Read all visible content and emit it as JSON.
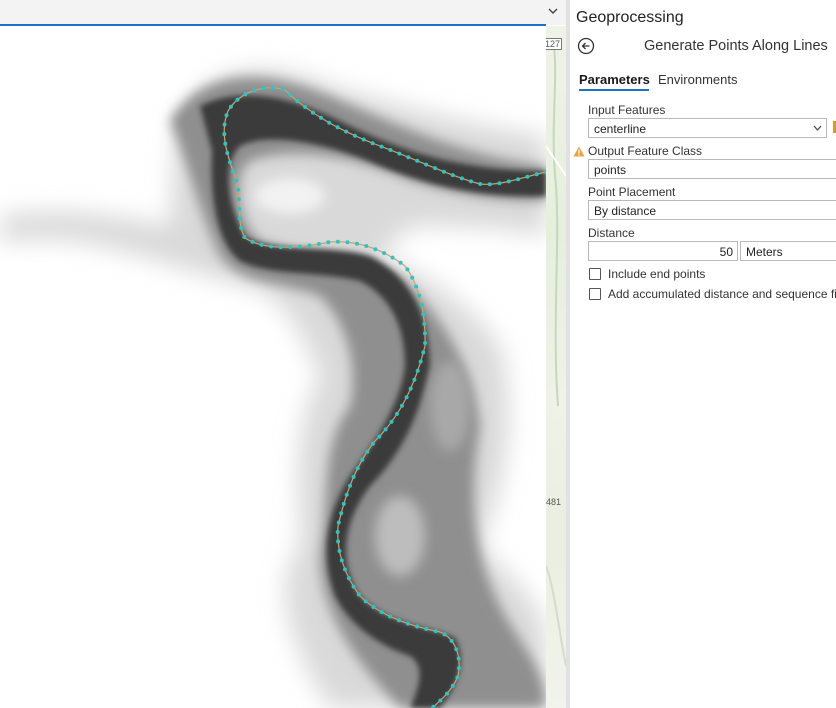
{
  "map": {
    "road_labels": [
      "127",
      "481"
    ],
    "colors": {
      "points": "#2ec4c4",
      "line": "#c9a56b",
      "selection_rule": "#1e72c4"
    }
  },
  "geoprocessing": {
    "pane_title": "Geoprocessing",
    "tool_title": "Generate Points Along Lines",
    "tabs": [
      "Parameters",
      "Environments"
    ],
    "input_features": {
      "label": "Input Features",
      "value": "centerline"
    },
    "output_feature_class": {
      "label": "Output Feature Class",
      "value": "points",
      "warning": true
    },
    "point_placement": {
      "label": "Point Placement",
      "value": "By distance"
    },
    "distance": {
      "label": "Distance",
      "value": "50",
      "unit": "Meters"
    },
    "checkboxes": [
      {
        "label": "Include end points",
        "checked": false
      },
      {
        "label": "Add accumulated distance and sequence fi",
        "checked": false
      }
    ]
  }
}
